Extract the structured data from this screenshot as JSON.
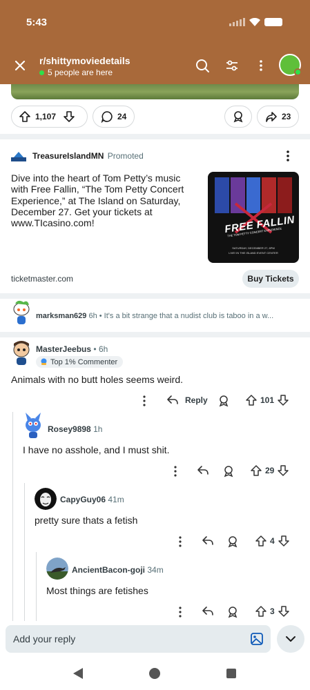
{
  "status_bar": {
    "time": "5:43"
  },
  "header": {
    "subreddit": "r/shittymoviedetails",
    "online": "5 people are here",
    "icons": [
      "close-icon",
      "search-icon",
      "filter-icon",
      "more-vertical-icon",
      "avatar"
    ]
  },
  "post_actions": {
    "upvotes": "1,107",
    "comments": "24",
    "shares": "23"
  },
  "promo": {
    "advertiser": "TreasureIslandMN",
    "tag": "Promoted",
    "text": "Dive into the heart of Tom Petty’s music with Free Fallin, “The Tom Petty Concert Experience,” at The Island on Saturday, December 27. Get your tickets at www.TIcasino.com!",
    "image_title": "FREE FALLIN",
    "image_subtitle": "THE TOM PETTY CONCERT EXPERIENCE",
    "image_footer_1": "SATURDAY, DECEMBER 27, 8PM",
    "image_footer_2": "LIVE! IN THE ISLAND EVENT CENTER",
    "domain": "ticketmaster.com",
    "cta": "Buy Tickets"
  },
  "collapsed_comment": {
    "user": "marksman629",
    "time": "6h",
    "preview": "It's a bit strange that a nudist club is taboo in a w..."
  },
  "comments": [
    {
      "user": "MasterJeebus",
      "time": "6h",
      "badge": "Top 1% Commenter",
      "body": "Animals with no butt holes seems weird.",
      "reply_label": "Reply",
      "score": "101"
    },
    {
      "user": "Rosey9898",
      "time": "1h",
      "body": "I have no asshole, and I must shit.",
      "score": "29"
    },
    {
      "user": "CapyGuy06",
      "time": "41m",
      "body": "pretty sure thats a fetish",
      "score": "4"
    },
    {
      "user": "AncientBacon-goji",
      "time": "34m",
      "body": "Most things are fetishes",
      "score": "3"
    }
  ],
  "reply_bar": {
    "placeholder": "Add your reply"
  },
  "colors": {
    "header": "#a8693a",
    "online": "#2ee04a"
  }
}
